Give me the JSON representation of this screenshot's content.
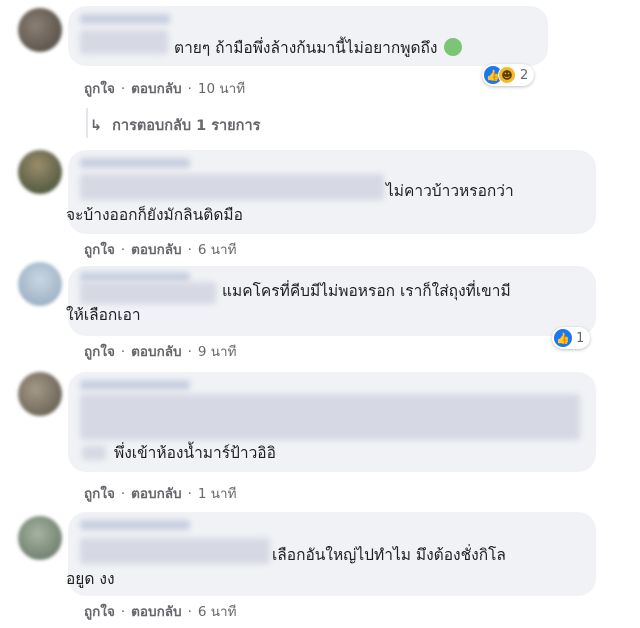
{
  "actions": {
    "like": "ถูกใจ",
    "reply": "ตอบกลับ",
    "separator": "·"
  },
  "comments": [
    {
      "text_lines": [
        "ตายๆ ถ้ามือพึ่งล้างก้นมานี้ไม่อยากพูดถึง"
      ],
      "emoji": "sick-face",
      "time": "10 นาที",
      "reactions": {
        "icons": [
          "like-icon",
          "haha-icon"
        ],
        "count": "2"
      },
      "view_replies": "การตอบกลับ 1 รายการ"
    },
    {
      "text_lines": [
        "ไม่คาวบ้าวหรอกว่า",
        "จะบ้างออกก็ยังมักลินติดมือ"
      ],
      "time": "6 นาที"
    },
    {
      "text_lines": [
        "แมคโครที่คีบมีไม่พอหรอก เราก็ใส่ถุงที่เขามี",
        "ให้เลือกเอา"
      ],
      "time": "9 นาที",
      "reactions": {
        "icons": [
          "like-icon"
        ],
        "count": "1"
      }
    },
    {
      "text_lines": [
        "พึ่งเข้าห้องน้ำมาร์ป้าวอิอิ"
      ],
      "time": "1 นาที"
    },
    {
      "text_lines": [
        "เลือกอันใหญ่ไปทำไม มึงต้องชั่งกิโล",
        "อยูด งง"
      ],
      "time": "6 นาที"
    }
  ],
  "colors": {
    "bubble": "#f0f2f5",
    "meta": "#65676b",
    "like": "#1877f2",
    "haha": "#f7b928"
  }
}
